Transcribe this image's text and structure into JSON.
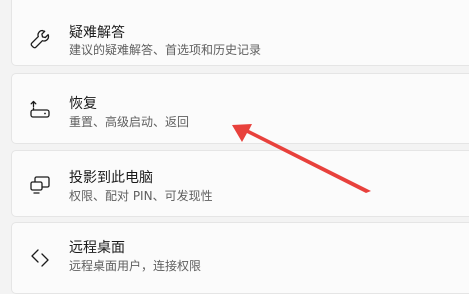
{
  "settings_items": [
    {
      "title": "疑难解答",
      "subtitle": "建议的疑难解答、首选项和历史记录",
      "icon": "wrench-icon"
    },
    {
      "title": "恢复",
      "subtitle": "重置、高级启动、返回",
      "icon": "recovery-icon"
    },
    {
      "title": "投影到此电脑",
      "subtitle": "权限、配对 PIN、可发现性",
      "icon": "project-to-pc-icon"
    },
    {
      "title": "远程桌面",
      "subtitle": "远程桌面用户，连接权限",
      "icon": "remote-desktop-icon"
    }
  ],
  "annotation": {
    "color": "#e8413c",
    "points_to": "恢复"
  }
}
